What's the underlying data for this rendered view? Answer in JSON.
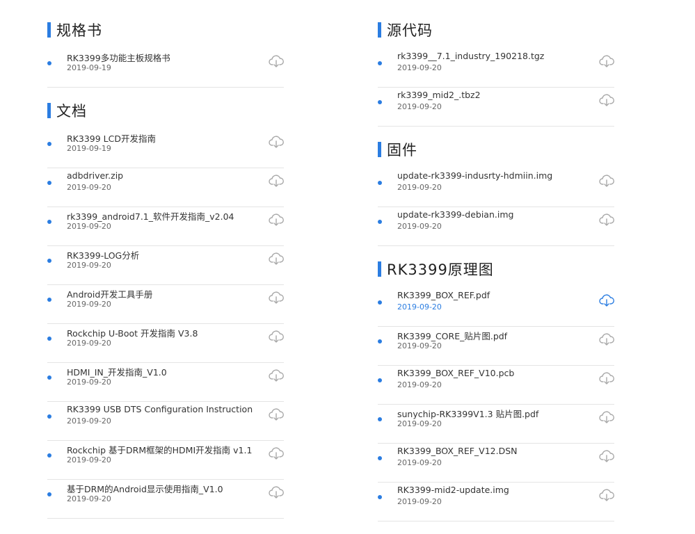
{
  "left_sections": [
    {
      "title": "规格书",
      "items": [
        {
          "name": "RK3399多功能主板规格书",
          "date": "2019-09-19"
        }
      ]
    },
    {
      "title": "文档",
      "items": [
        {
          "name": "RK3399 LCD开发指南",
          "date": "2019-09-19"
        },
        {
          "name": "adbdriver.zip",
          "date": "2019-09-20"
        },
        {
          "name": "rk3399_android7.1_软件开发指南_v2.04",
          "date": "2019-09-20"
        },
        {
          "name": "RK3399-LOG分析",
          "date": "2019-09-20"
        },
        {
          "name": "Android开发工具手册",
          "date": "2019-09-20"
        },
        {
          "name": "Rockchip U-Boot 开发指南 V3.8",
          "date": "2019-09-20"
        },
        {
          "name": "HDMI_IN_开发指南_V1.0",
          "date": "2019-09-20"
        },
        {
          "name": "RK3399 USB DTS Configuration Instruction",
          "date": "2019-09-20"
        },
        {
          "name": "Rockchip 基于DRM框架的HDMI开发指南 v1.1",
          "date": "2019-09-20"
        },
        {
          "name": "基于DRM的Android显示使用指南_V1.0",
          "date": "2019-09-20"
        }
      ]
    }
  ],
  "right_sections": [
    {
      "title": "源代码",
      "items": [
        {
          "name": "rk3399__7.1_industry_190218.tgz",
          "date": "2019-09-20"
        },
        {
          "name": "rk3399_mid2_.tbz2",
          "date": "2019-09-20"
        }
      ]
    },
    {
      "title": "固件",
      "items": [
        {
          "name": "update-rk3399-indusrty-hdmiin.img",
          "date": "2019-09-20"
        },
        {
          "name": "update-rk3399-debian.img",
          "date": "2019-09-20"
        }
      ]
    },
    {
      "title": "RK3399原理图",
      "items": [
        {
          "name": "RK3399_BOX_REF.pdf",
          "date": "2019-09-20",
          "active": true
        },
        {
          "name": "RK3399_CORE_贴片图.pdf",
          "date": "2019-09-20"
        },
        {
          "name": "RK3399_BOX_REF_V10.pcb",
          "date": "2019-09-20"
        },
        {
          "name": "sunychip-RK3399V1.3 贴片图.pdf",
          "date": "2019-09-20"
        },
        {
          "name": "RK3399_BOX_REF_V12.DSN",
          "date": "2019-09-20"
        },
        {
          "name": "RK3399-mid2-update.img",
          "date": "2019-09-20"
        }
      ]
    }
  ],
  "icons": {
    "bullet": "dot-icon",
    "download": "cloud-download-icon"
  },
  "colors": {
    "accent": "#2b7de1",
    "icon_default": "#a9a9a9",
    "icon_active": "#2b7de1"
  }
}
